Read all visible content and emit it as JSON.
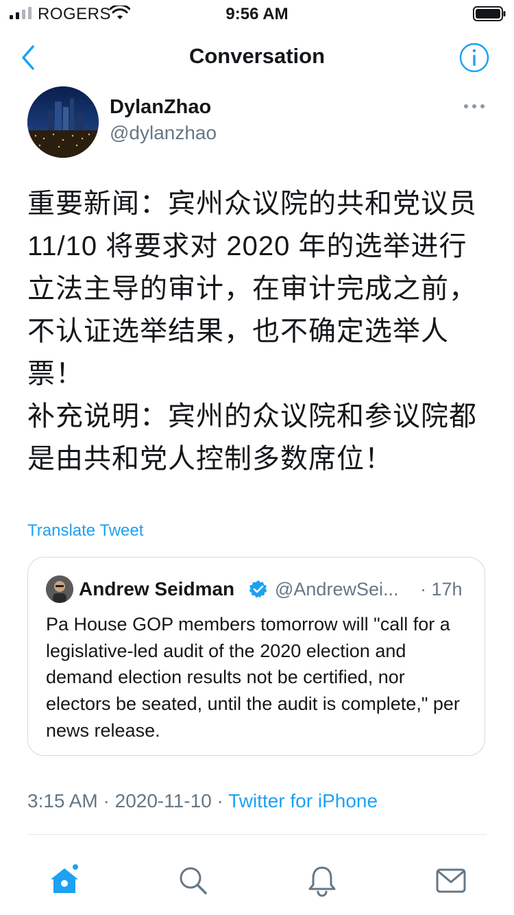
{
  "status_bar": {
    "carrier": "ROGERS",
    "time": "9:56 AM"
  },
  "nav": {
    "title": "Conversation"
  },
  "tweet": {
    "author_name": "DylanZhao",
    "author_handle": "@dylanzhao",
    "text_lines": [
      "重要新闻：宾州众议院的共和党议员 11/10 将要求对 2020 年的选举进行立法主导的审计，在审计完成之前，不认证选举结果，也不确定选举人票！",
      "补充说明：宾州的众议院和参议院都是由共和党人控制多数席位！"
    ],
    "translate_label": "Translate Tweet",
    "time": "3:15 AM",
    "date": "2020-11-10",
    "separator": " · ",
    "source": "Twitter for iPhone"
  },
  "quoted_tweet": {
    "name": "Andrew Seidman",
    "handle": "@AndrewSei...",
    "time": "· 17h",
    "text": "Pa House GOP members tomorrow will \"call for a legislative-led audit of the 2020 election and demand election results not be certified, nor electors be seated, until the audit is complete,\" per news release."
  },
  "tab_bar": {
    "items": [
      "home-icon",
      "search-icon",
      "bell-icon",
      "mail-icon"
    ],
    "home_badge": true
  },
  "colors": {
    "accent": "#1da1f2",
    "secondary_text": "#657786",
    "primary_text": "#14171a",
    "border": "#d3dbe2"
  }
}
